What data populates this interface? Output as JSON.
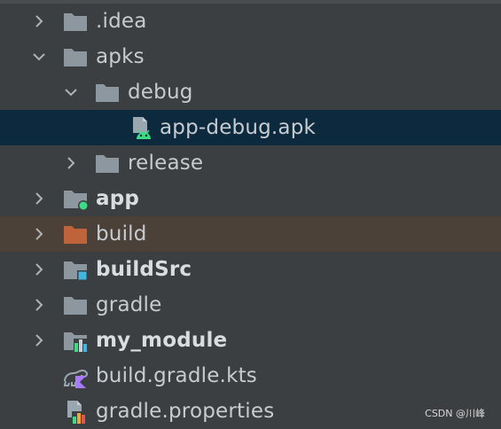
{
  "tree": {
    "rows": [
      {
        "label": ".idea",
        "expander": "collapsed",
        "icon": "folder-icon"
      },
      {
        "label": "apks",
        "expander": "expanded",
        "icon": "folder-icon"
      },
      {
        "label": "debug",
        "expander": "expanded",
        "icon": "folder-icon"
      },
      {
        "label": "app-debug.apk",
        "expander": "none",
        "icon": "apk-file-icon",
        "selected": true
      },
      {
        "label": "release",
        "expander": "collapsed",
        "icon": "folder-icon"
      },
      {
        "label": "app",
        "expander": "collapsed",
        "icon": "android-module-folder-icon"
      },
      {
        "label": "build",
        "expander": "collapsed",
        "icon": "excluded-folder-icon"
      },
      {
        "label": "buildSrc",
        "expander": "collapsed",
        "icon": "module-folder-icon"
      },
      {
        "label": "gradle",
        "expander": "collapsed",
        "icon": "folder-icon"
      },
      {
        "label": "my_module",
        "expander": "collapsed",
        "icon": "library-module-folder-icon"
      },
      {
        "label": "build.gradle.kts",
        "expander": "none",
        "icon": "gradle-kotlin-script-icon"
      },
      {
        "label": "gradle.properties",
        "expander": "none",
        "icon": "gradle-properties-icon"
      }
    ]
  },
  "watermark": "CSDN @川峰",
  "colors": {
    "background": "#3c3f41",
    "selection": "#0d293e",
    "excluded_row": "#4b4139",
    "folder": "#8c97a0",
    "excluded_folder": "#bf633a",
    "android_green": "#3ddc84"
  }
}
